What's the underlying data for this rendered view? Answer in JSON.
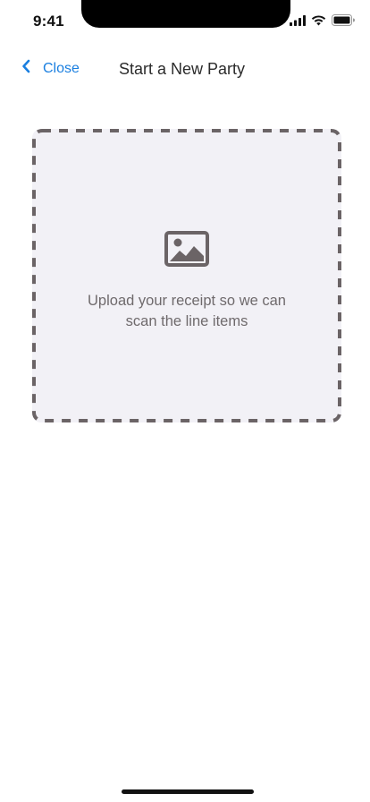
{
  "status_bar": {
    "time": "9:41",
    "icons": [
      "cellular-signal-icon",
      "wifi-icon",
      "battery-icon"
    ]
  },
  "nav": {
    "back_icon": "chevron-left-icon",
    "close_label": "Close",
    "title": "Start a New Party"
  },
  "upload": {
    "icon": "image-icon",
    "line1": "Upload your receipt so we can",
    "line2": "scan the line items"
  },
  "colors": {
    "accent": "#1a7fe0",
    "upload_bg": "#f2f1f6",
    "dash_border": "#6b6466",
    "muted_text": "#6f6a6c"
  }
}
